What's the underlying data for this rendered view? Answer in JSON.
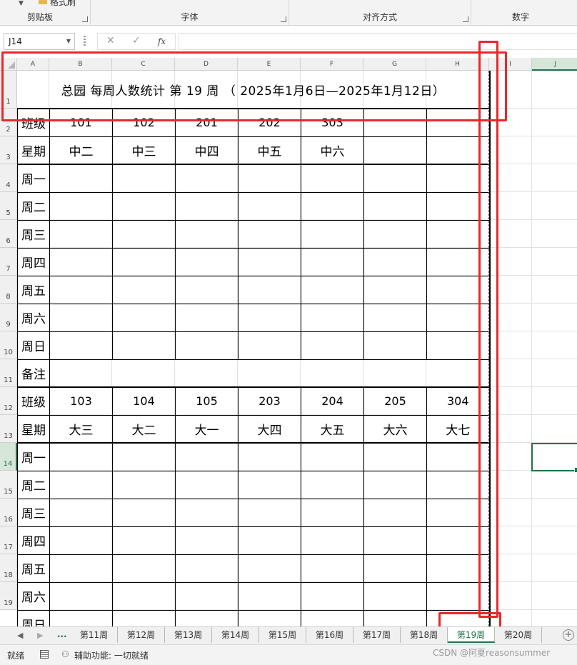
{
  "ribbon": {
    "clipboard_label": "剪贴板",
    "format_painter_label": "格式刷",
    "font_label": "字体",
    "align_label": "对齐方式",
    "number_label": "数字"
  },
  "formula_bar": {
    "name_box": "J14",
    "cancel_glyph": "✕",
    "enter_glyph": "✓",
    "fx_glyph": "fx",
    "value": ""
  },
  "columns": [
    "A",
    "B",
    "C",
    "D",
    "E",
    "F",
    "G",
    "H",
    "I",
    "J"
  ],
  "rows": [
    "1",
    "2",
    "3",
    "4",
    "5",
    "6",
    "7",
    "8",
    "9",
    "10",
    "11",
    "12",
    "13",
    "14",
    "15",
    "16",
    "17",
    "18",
    "19"
  ],
  "sheet": {
    "title": "总园  每周人数统计  第 19 周  （ 2025年1月6日—2025年1月12日）",
    "block1": {
      "class_label": "班级",
      "classes": [
        "101",
        "102",
        "201",
        "202",
        "303",
        "",
        ""
      ],
      "week_label": "星期",
      "grades": [
        "中二",
        "中三",
        "中四",
        "中五",
        "中六",
        "",
        ""
      ],
      "days": [
        "周一",
        "周二",
        "周三",
        "周四",
        "周五",
        "周六",
        "周日"
      ]
    },
    "notes_label": "备注",
    "block2": {
      "class_label": "班级",
      "classes": [
        "103",
        "104",
        "105",
        "203",
        "204",
        "205",
        "304"
      ],
      "week_label": "星期",
      "grades": [
        "大三",
        "大二",
        "大一",
        "大四",
        "大五",
        "大六",
        "大七"
      ],
      "days": [
        "周一",
        "周二",
        "周三",
        "周四",
        "周五",
        "周六",
        "周日"
      ]
    }
  },
  "tabs": {
    "ellipsis": "...",
    "items": [
      "第11周",
      "第12周",
      "第13周",
      "第14周",
      "第15周",
      "第16周",
      "第17周",
      "第18周",
      "第19周",
      "第20周"
    ],
    "active": "第19周"
  },
  "status": {
    "ready": "就绪",
    "accessibility": "辅助功能: 一切就绪"
  },
  "watermark": "CSDN @阿夏reasonsummer",
  "colors": {
    "excel_green": "#217346",
    "highlight_red": "#e8282b"
  }
}
